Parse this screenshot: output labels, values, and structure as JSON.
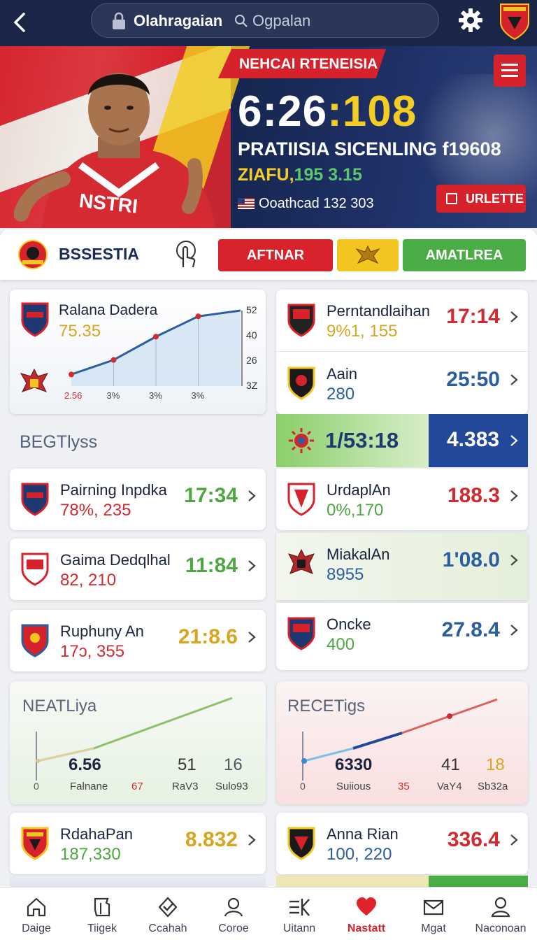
{
  "header": {
    "title": "Olahragaian",
    "search_placeholder": "Ogpalan"
  },
  "hero": {
    "banner": "NEHCAI RTENEISIA",
    "time_white": "6:26",
    "time_yellow": ":108",
    "line1": "PRATIISIA SICENLING f19608",
    "line2_a": "ZIAFU,",
    "line2_b": "195 3.15",
    "line3": "Ooathcad 132 303",
    "update_label": "URLETTE",
    "colors": {
      "red": "#d5222b",
      "yellow": "#f3cc24",
      "navy": "#1a2547"
    }
  },
  "teambar": {
    "name": "BSSESTIA",
    "btn1": "AFTNAR",
    "btn3": "AMATLREA"
  },
  "chart_card": {
    "title": "Ralana Dadera",
    "value": "75.35",
    "chart_data": {
      "type": "line",
      "x_labels": [
        "2.56",
        "3%",
        "3%",
        "3%"
      ],
      "y_ticks": [
        "52",
        "40",
        "26",
        "3Z"
      ],
      "values": [
        8,
        18,
        34,
        48,
        52
      ]
    }
  },
  "section_left": "BEGTlyss",
  "right_list": [
    {
      "name": "Perntandlaihan",
      "sub": "9%1, 155",
      "value": "17:14",
      "sub_color": "gold",
      "val_color": "red"
    },
    {
      "name": "Aain",
      "sub": "280",
      "value": "25:50",
      "sub_color": "blue",
      "val_color": "blue"
    }
  ],
  "highlight": {
    "left": "1/53:18",
    "right": "4.383"
  },
  "left_list": [
    {
      "name": "Pairning Inpdka",
      "sub": "78%, 235",
      "value": "17:34",
      "sub_color": "red",
      "val_color": "green"
    },
    {
      "name": "Gaima Dedqlhal",
      "sub": "82, 210",
      "value": "11:84",
      "sub_color": "red",
      "val_color": "green"
    },
    {
      "name": "Ruphuny An",
      "sub": "17ɔ, 355",
      "value": "21:8.6",
      "sub_color": "red",
      "val_color": "gold"
    }
  ],
  "right_list2": [
    {
      "name": "UrdaplAn",
      "sub": "0%,170",
      "value": "188.3",
      "sub_color": "green",
      "val_color": "red"
    },
    {
      "name": "MiakalAn",
      "sub": "8955",
      "value": "1'08.0",
      "sub_color": "blue",
      "val_color": "blue"
    },
    {
      "name": "Oncke",
      "sub": "400",
      "value": "27.8.4",
      "sub_color": "green",
      "val_color": "blue"
    }
  ],
  "mini_left": {
    "title": "NEATLiya",
    "axis0": "0",
    "stats": [
      {
        "value": "6.56",
        "label": "Falnane"
      },
      {
        "value": "",
        "label": "67"
      },
      {
        "value": "51",
        "label": "RaV3"
      },
      {
        "value": "16",
        "label": "Sulo93"
      }
    ]
  },
  "mini_right": {
    "title": "RECETigs",
    "axis0": "0",
    "stats": [
      {
        "value": "6330",
        "label": "Suiious"
      },
      {
        "value": "",
        "label": "35"
      },
      {
        "value": "41",
        "label": "VaY4"
      },
      {
        "value": "18",
        "label": "Sb32a"
      }
    ]
  },
  "bottom_cards": [
    {
      "name": "RdahaPan",
      "sub": "187,330",
      "value": "8.832"
    },
    {
      "name": "Anna Rian",
      "sub": "100, 220",
      "value": "336.4"
    }
  ],
  "nav": [
    {
      "label": "Daige"
    },
    {
      "label": "Tiigek"
    },
    {
      "label": "Ccahah"
    },
    {
      "label": "Coroe"
    },
    {
      "label": "Uitann"
    },
    {
      "label": "Nastatt"
    },
    {
      "label": "Mgat"
    },
    {
      "label": "Naconoan"
    }
  ]
}
